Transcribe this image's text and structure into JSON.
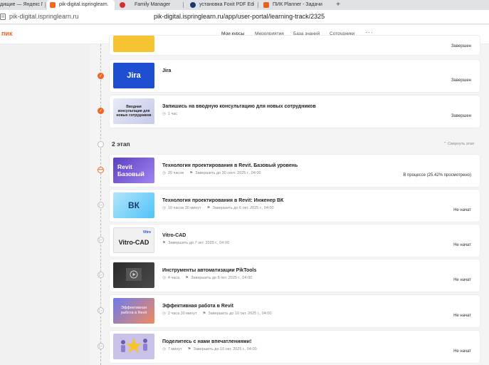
{
  "browser": {
    "tabs": [
      {
        "label": "дищие — Яндекс П",
        "color": "#fff"
      },
      {
        "label": "pik-digital.ispringlearn.",
        "color": "#f26522",
        "active": true
      },
      {
        "label": "Family Manager",
        "color": "#d32f2f"
      },
      {
        "label": "установка Foxit PDF Edit",
        "color": "#1a3a6b"
      },
      {
        "label": "ПИК Planner - Задачи",
        "color": "#e8611a"
      }
    ],
    "close_glyph": "✕",
    "newtab_glyph": "+",
    "host": "pik-digital.ispringlearn.ru",
    "url": "pik-digital.ispringlearn.ru/app/user-portal/learning-track/2325"
  },
  "header": {
    "logo": "пик",
    "nav": [
      "Мои курсы",
      "Мероприятия",
      "База знаний",
      "Сотрудники"
    ],
    "more": "···"
  },
  "stage2": {
    "title": "2 этап",
    "collapse": "⌃ Свернуть этап"
  },
  "cards": [
    {
      "title": "",
      "meta1": "",
      "meta2": "",
      "status": "Завершен",
      "thumb_text": ""
    },
    {
      "title": "Jira",
      "meta1": "",
      "meta2": "",
      "status": "Завершен",
      "thumb_text": "Jira"
    },
    {
      "title": "Запишись на вводную консультацию для новых сотрудников",
      "meta1": "1 час",
      "meta2": "",
      "status": "Завершен",
      "thumb_text": "Вводная консультация для новых сотрудников"
    },
    {
      "title": "Технология проектирования в Revit. Базовый уровень",
      "meta1": "20 часов",
      "meta2": "Завершить до 30 сент. 2025 г., 04:00",
      "status": "В процессе (25.42% просмотрено)",
      "thumb_text": "Revit Базовый"
    },
    {
      "title": "Технология проектирования в Revit: Инженер ВК",
      "meta1": "10 часов 30 минут",
      "meta2": "Завершить до 6 окт. 2025 г., 04:00",
      "status": "Не начат",
      "thumb_text": "ВК"
    },
    {
      "title": "Vitro-CAD",
      "meta1": "",
      "meta2": "Завершить до 7 окт. 2025 г., 04:00",
      "status": "Не начат",
      "thumb_text": "Vitro-CAD"
    },
    {
      "title": "Инструменты автоматизации PikTools",
      "meta1": "4 часа",
      "meta2": "Завершить до 8 окт. 2025 г., 04:00",
      "status": "Не начат",
      "thumb_text": ""
    },
    {
      "title": "Эффективная работа в Revit",
      "meta1": "2 часа 30 минут",
      "meta2": "Завершить до 10 окт. 2025 г., 04:00",
      "status": "Не начат",
      "thumb_text": "Эффективная работа в Revit"
    },
    {
      "title": "Поделитесь с нами впечатлениями!",
      "meta1": "7 минут",
      "meta2": "Завершить до 10 окт. 2025 г., 04:00",
      "status": "Не начат",
      "thumb_text": ""
    }
  ],
  "thumb_vitro_badge": "Vitro"
}
